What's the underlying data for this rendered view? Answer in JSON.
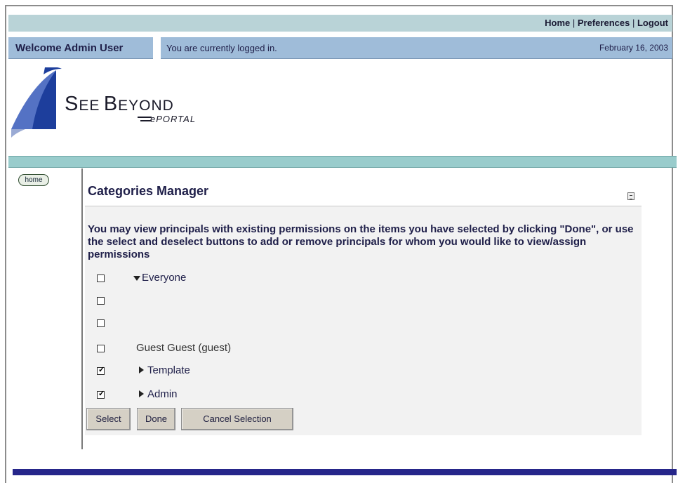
{
  "topnav": {
    "home": "Home",
    "preferences": "Preferences",
    "logout": "Logout",
    "sep": " | "
  },
  "welcome": "Welcome Admin User",
  "status_message": "You are currently logged in.",
  "date": "February 16, 2003",
  "logo": {
    "S": "S",
    "EE": "EE",
    "B": "B",
    "EYOND": "EYOND",
    "eportal": "ePORTAL"
  },
  "nav": {
    "home_label": "home"
  },
  "portlet": {
    "title": "Categories Manager",
    "instructions": "You may view principals with existing permissions on the items you have selected by clicking \"Done\", or use the select and deselect buttons to add or remove principals for whom you would like to view/assign permissions",
    "principals": [
      {
        "label": "Everyone",
        "checked": false,
        "expander": "down"
      },
      {
        "label": "",
        "checked": false,
        "expander": "none"
      },
      {
        "label": "",
        "checked": false,
        "expander": "none"
      },
      {
        "label": "Guest Guest (guest)",
        "checked": false,
        "expander": "none"
      },
      {
        "label": "Template",
        "checked": true,
        "expander": "right"
      },
      {
        "label": "Admin",
        "checked": true,
        "expander": "right"
      }
    ],
    "buttons": {
      "select": "Select",
      "done": "Done",
      "cancel": "Cancel Selection"
    }
  },
  "colors": {
    "topnav_bg": "#b9d3d7",
    "welcome_bg": "#9fbcd9",
    "teal_bar": "#99cccc",
    "footer_bar": "#26268a",
    "text": "#20204a"
  }
}
